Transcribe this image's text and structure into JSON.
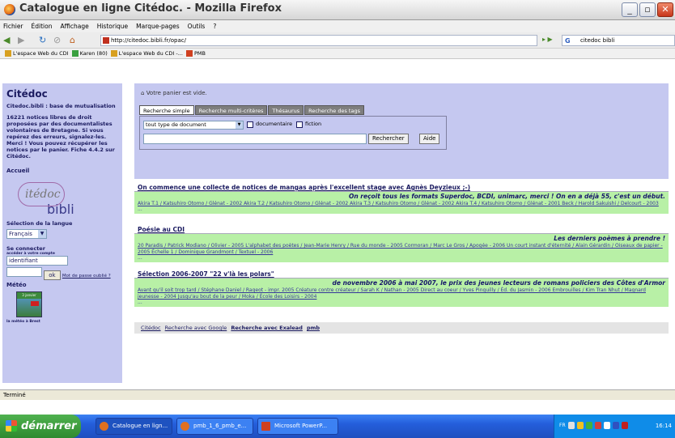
{
  "window": {
    "title": "Catalogue en ligne Citédoc. - Mozilla Firefox"
  },
  "menu": [
    "Fichier",
    "Édition",
    "Affichage",
    "Historique",
    "Marque-pages",
    "Outils",
    "?"
  ],
  "nav": {
    "url": "http://citedoc.bibli.fr/opac/",
    "search_value": "citedoc bibli"
  },
  "bookmarks": [
    "L'espace Web du CDI",
    "Karen (80)",
    "L'espace Web du CDI -...",
    "PMB"
  ],
  "sidebar": {
    "title": "Citédoc",
    "subtitle": "Citedoc.bibli : base de mutualisation",
    "info": "16221 notices libres de droit proposées par des documentalistes volontaires de Bretagne. Si vous repérez des erreurs, signalez-les. Merci ! Vous pouvez récupérer les notices par le panier. Fiche 4.4.2 sur Citédoc.",
    "accueil": "Accueil",
    "logo_script": "itédoc",
    "logo_text": "bibli",
    "lang_label": "Sélection de la langue",
    "lang_value": "Français",
    "connect_label": "Se connecter",
    "connect_sub": "accéder à votre compte",
    "login_value": "identifiant",
    "ok_label": "ok",
    "forgot_label": "Mot de passe oublié ?",
    "meteo_label": "Météo",
    "meteo_date": "3 janvier",
    "meteo_caption": "la météo à Brest"
  },
  "main": {
    "basket": "Votre panier est vide.",
    "tabs": [
      "Recherche simple",
      "Recherche multi-critères",
      "Thésaurus",
      "Recherche des tags"
    ],
    "doc_type": "tout type de document",
    "chk1": "documentaire",
    "chk2": "fiction",
    "search_button": "Rechercher",
    "help_button": "Aide"
  },
  "sections": [
    {
      "title": "On commence une collecte de notices de mangas après l'excellent stage avec Agnès Deyzieux ;-)",
      "desc": "On reçoit tous les formats Superdoc, BCDI, unimarc, merci ! On en a déjà 55, c'est un début.",
      "items": "Akira T.1 / Katsuhiro Otomo / Glénat - 2002 Akira T.2 / Katsuhiro Otomo / Glénat - 2002 Akira T.3 / Katsuhiro Otomo / Glénat - 2002 Akira T.4 / Katsuhiro Otomo / Glénat - 2001 Beck / Harold Sakuishi / Delcourt - 2003",
      "more": "..."
    },
    {
      "title": "Poésie au CDI",
      "desc": "Les derniers poèmes à prendre !",
      "items": "20 Paradis / Patrick Modiano / Olivier - 2005 L'alphabet des poètes / Jean-Marie Henry / Rue du monde - 2005 Cormoran / Marc Le Gros / Apogée - 2006 Un court instant d'éternité / Alain Gérardin / Oiseaux de papier - 2005 Échelle 1 / Dominique Grandmont / Textuel - 2006",
      "more": "..."
    },
    {
      "title": "Sélection 2006-2007 \"22 v'là les polars\"",
      "desc": "de novembre 2006 à mai 2007, le prix des jeunes lecteurs de romans policiers des Côtes d'Armor",
      "items": "Avant qu'il soit trop tard / Stéphane Daniel / Rageot - impr. 2005 Créature contre créateur / Sarah K / Nathan - 2005 Direct au coeur / Yves Pinguilly / Éd. du Jasmin - 2006 Embrouilles / Kim Tran Nhut / Magnard jeunesse - 2004 Jusqu'au bout de la peur / Moka / École des Loisirs - 2004",
      "more": "..."
    }
  ],
  "footer": [
    "Citédoc",
    "Recherche avec Google",
    "Recherche avec Exalead",
    "pmb"
  ],
  "status": "Terminé",
  "taskbar": {
    "start": "démarrer",
    "tasks": [
      "Catalogue en lign...",
      "pmb_1_6_pmb_e...",
      "Microsoft PowerP..."
    ],
    "clock": "16:14",
    "lang": "FR"
  }
}
